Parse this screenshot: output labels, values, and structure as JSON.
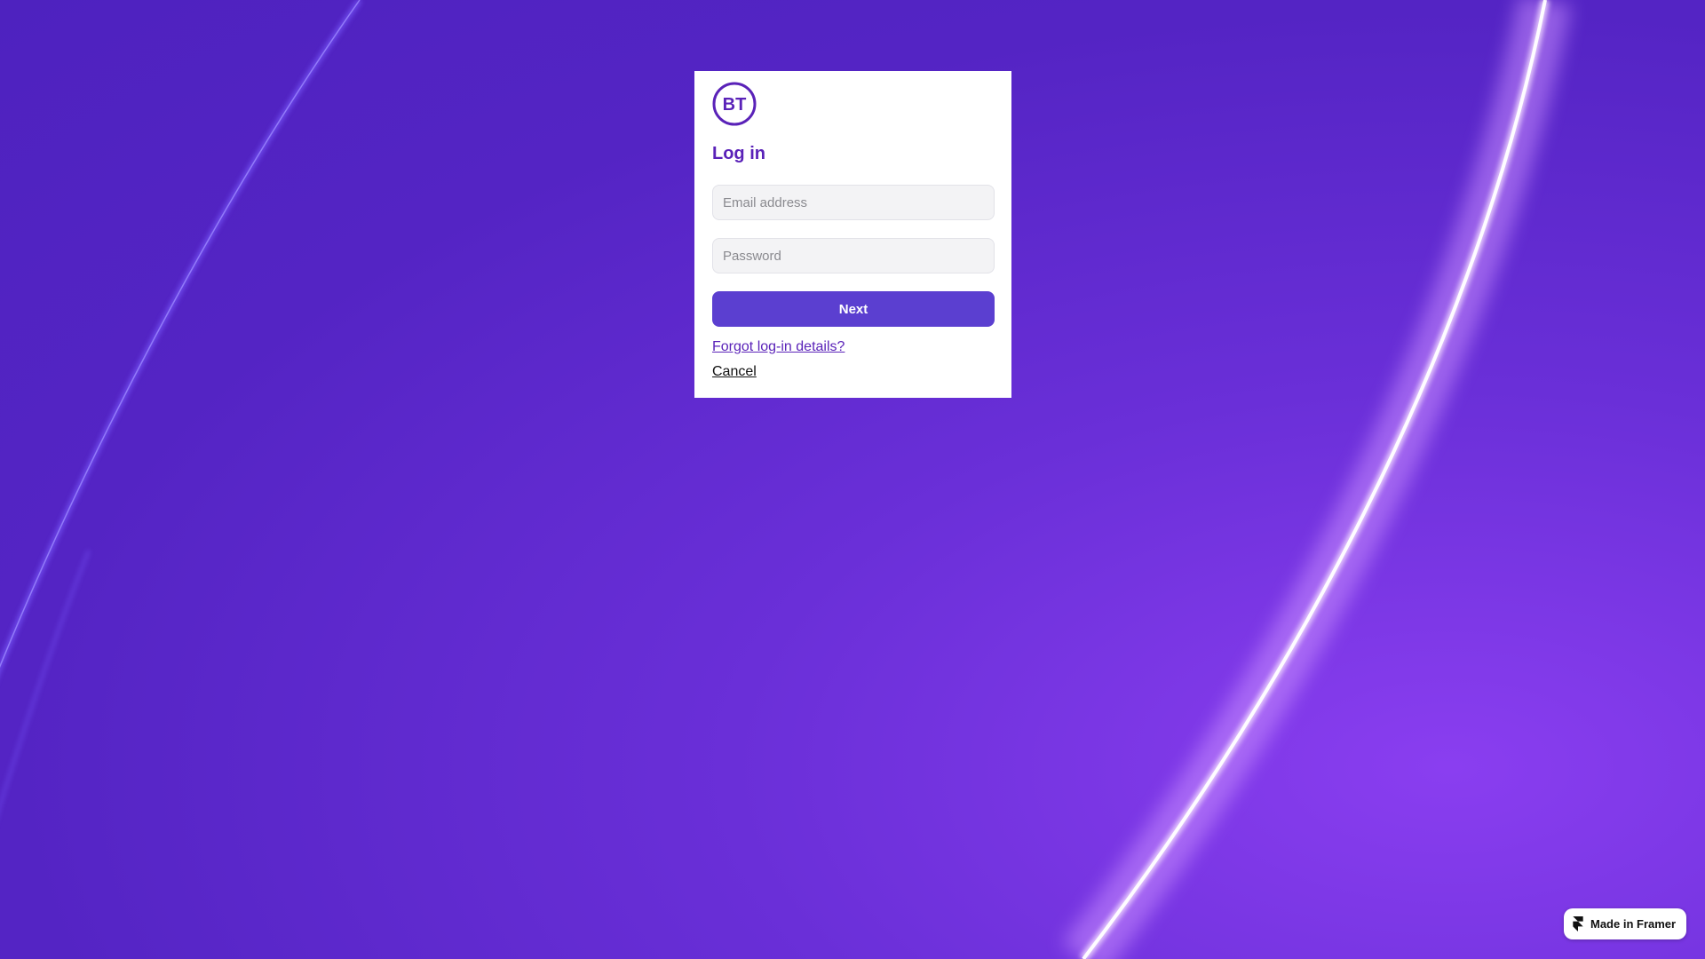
{
  "brand": {
    "logo_text": "BT",
    "color": "#5a22b8"
  },
  "login": {
    "title": "Log in",
    "email_placeholder": "Email address",
    "password_placeholder": "Password",
    "next_label": "Next",
    "forgot_label": "Forgot log-in details?",
    "cancel_label": "Cancel"
  },
  "badge": {
    "label": "Made in Framer",
    "icon": "framer-icon"
  },
  "colors": {
    "background": "#5424c4",
    "button": "#5b3fd0",
    "accent": "#5a22b8"
  }
}
